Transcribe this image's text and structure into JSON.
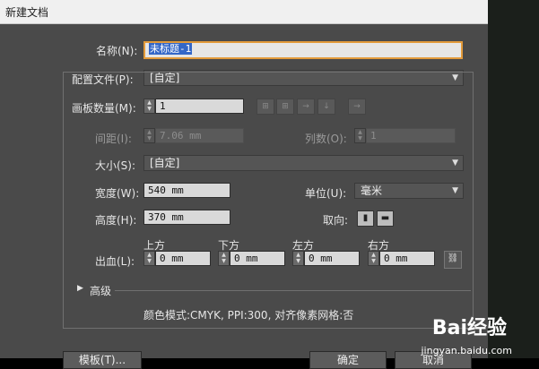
{
  "window": {
    "title": "新建文档"
  },
  "name": {
    "label": "名称(N):",
    "value": "未标题-1"
  },
  "profile": {
    "label": "配置文件(P):",
    "value": "[自定]"
  },
  "artboards": {
    "label": "画板数量(M):",
    "value": "1"
  },
  "spacing": {
    "label": "间距(I):",
    "value": "7.06 mm"
  },
  "columns": {
    "label": "列数(O):",
    "value": "1"
  },
  "size": {
    "label": "大小(S):",
    "value": "[自定]"
  },
  "width": {
    "label": "宽度(W):",
    "value": "540 mm"
  },
  "units": {
    "label": "单位(U):",
    "value": "毫米"
  },
  "height": {
    "label": "高度(H):",
    "value": "370 mm"
  },
  "orientation": {
    "label": "取向:"
  },
  "bleed": {
    "label": "出血(L):",
    "top": {
      "label": "上方",
      "value": "0 mm"
    },
    "bottom": {
      "label": "下方",
      "value": "0 mm"
    },
    "left": {
      "label": "左方",
      "value": "0 mm"
    },
    "right": {
      "label": "右方",
      "value": "0 mm"
    }
  },
  "advanced": {
    "label": "高级"
  },
  "summary": "颜色模式:CMYK, PPI:300, 对齐像素网格:否",
  "buttons": {
    "template": "模板(T)...",
    "ok": "确定",
    "cancel": "取消"
  },
  "watermark": {
    "brand": "Bai经验",
    "url": "jingyan.baidu.com"
  }
}
